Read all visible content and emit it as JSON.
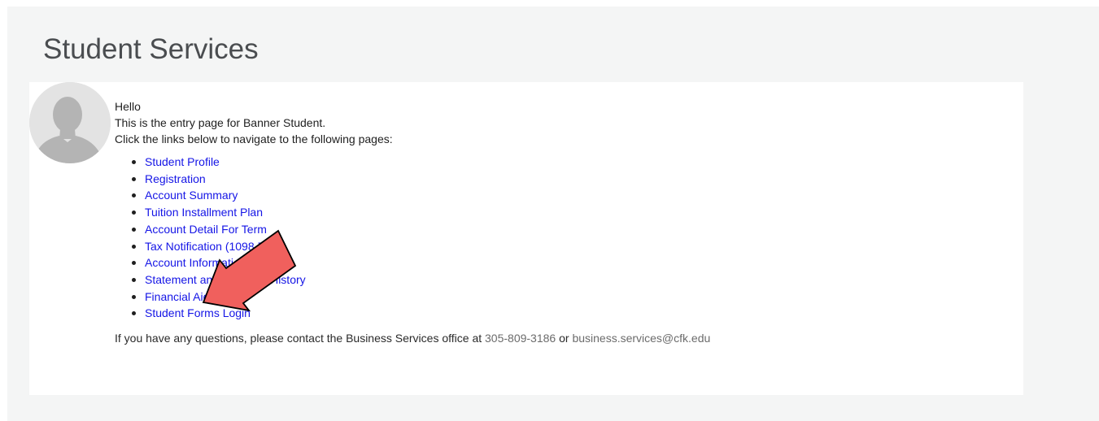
{
  "page": {
    "title": "Student Services"
  },
  "intro": {
    "greeting": "Hello",
    "line1": "This is the entry page for Banner Student.",
    "line2": "Click the links below to navigate to the following pages:"
  },
  "links": [
    {
      "label": "Student Profile"
    },
    {
      "label": "Registration"
    },
    {
      "label": "Account Summary"
    },
    {
      "label": "Tuition Installment Plan"
    },
    {
      "label": "Account Detail For Term"
    },
    {
      "label": "Tax Notification (1098-T)"
    },
    {
      "label": "Account Information"
    },
    {
      "label": "Statement and Payment History"
    },
    {
      "label": "Financial Aid"
    },
    {
      "label": "Student Forms Login"
    }
  ],
  "contact": {
    "prefix": "If you have any questions, please contact the Business Services office at ",
    "phone": "305-809-3186",
    "joiner": " or ",
    "email": "business.services@cfk.edu"
  },
  "colors": {
    "link": "#1515e6",
    "annotation_arrow": "#f0605d",
    "background": "#f4f5f5"
  },
  "icons": {
    "avatar": "default-user-silhouette",
    "annotation": "red-pointer-arrow"
  }
}
